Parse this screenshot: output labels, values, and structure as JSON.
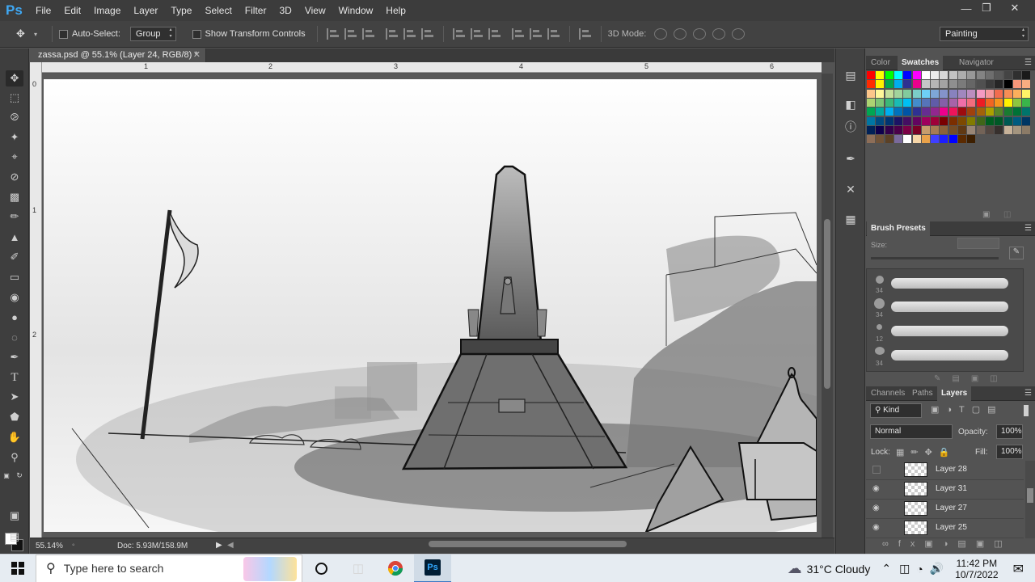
{
  "app": {
    "logo": "Ps",
    "menu": [
      "File",
      "Edit",
      "Image",
      "Layer",
      "Type",
      "Select",
      "Filter",
      "3D",
      "View",
      "Window",
      "Help"
    ],
    "window_controls": [
      "minimize-icon",
      "restore-icon",
      "close-icon"
    ]
  },
  "options_bar": {
    "auto_select_label": "Auto-Select:",
    "auto_select_value": "Group",
    "transform_label": "Show Transform Controls",
    "mode3d_label": "3D Mode:",
    "workspace": "Painting"
  },
  "document": {
    "tab_title": "zassa.psd @ 55.1% (Layer 24, RGB/8) *",
    "ruler_h": [
      "1",
      "2",
      "3",
      "4",
      "5",
      "6"
    ],
    "ruler_v": [
      "0",
      "1",
      "2"
    ],
    "zoom": "55.14%",
    "doc_info": "Doc: 5.93M/158.9M"
  },
  "panels": {
    "swatches_tabs": [
      "Color",
      "Swatches",
      "Navigator"
    ],
    "swatches_active": "Swatches",
    "brush_presets_title": "Brush Presets",
    "size_label": "Size:",
    "brush_sizes": [
      "34",
      "34",
      "12",
      "34"
    ],
    "layers_tabs": [
      "Channels",
      "Paths",
      "Layers"
    ],
    "layers_active": "Layers",
    "filter_kind": "Kind",
    "blend_mode": "Normal",
    "opacity_label": "Opacity:",
    "opacity_value": "100%",
    "lock_label": "Lock:",
    "fill_label": "Fill:",
    "fill_value": "100%",
    "layers": [
      {
        "name": "Layer 28",
        "visible": false
      },
      {
        "name": "Layer 31",
        "visible": true
      },
      {
        "name": "Layer 27",
        "visible": true
      },
      {
        "name": "Layer 25",
        "visible": true
      }
    ]
  },
  "taskbar": {
    "search_placeholder": "Type here to search",
    "weather": "31°C  Cloudy",
    "time": "11:42 PM",
    "date": "10/7/2022"
  },
  "colors": {
    "ps_blue": "#3fa9f5",
    "chrome_dark": "#3c3c3c",
    "panel_bg": "#535353"
  }
}
